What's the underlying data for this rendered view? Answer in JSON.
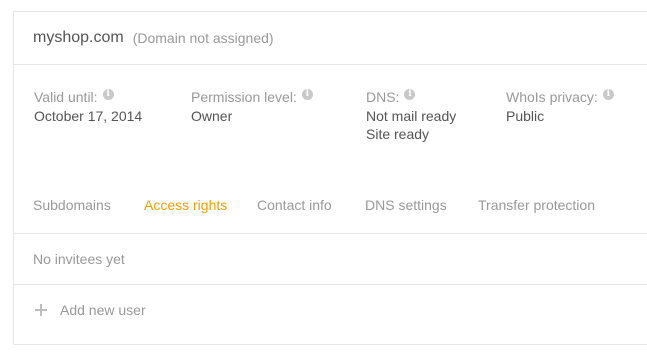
{
  "header": {
    "domain": "myshop.com",
    "status": "(Domain not assigned)"
  },
  "info": {
    "valid_until": {
      "label": "Valid until:",
      "value": "October 17, 2014"
    },
    "permission": {
      "label": "Permission level:",
      "value": "Owner"
    },
    "dns": {
      "label": "DNS:",
      "value_1": "Not mail ready",
      "value_2": "Site ready"
    },
    "whois": {
      "label": "WhoIs privacy:",
      "value": "Public"
    },
    "icon_glyph": "i"
  },
  "tabs": [
    {
      "label": "Subdomains",
      "active": false
    },
    {
      "label": "Access rights",
      "active": true
    },
    {
      "label": "Contact info",
      "active": false
    },
    {
      "label": "DNS settings",
      "active": false
    },
    {
      "label": "Transfer protection",
      "active": false
    }
  ],
  "access": {
    "empty_text": "No invitees yet",
    "add_label": "Add new user"
  },
  "colors": {
    "accent": "#f0a000",
    "muted": "#999999",
    "border": "#e6e6e6"
  }
}
